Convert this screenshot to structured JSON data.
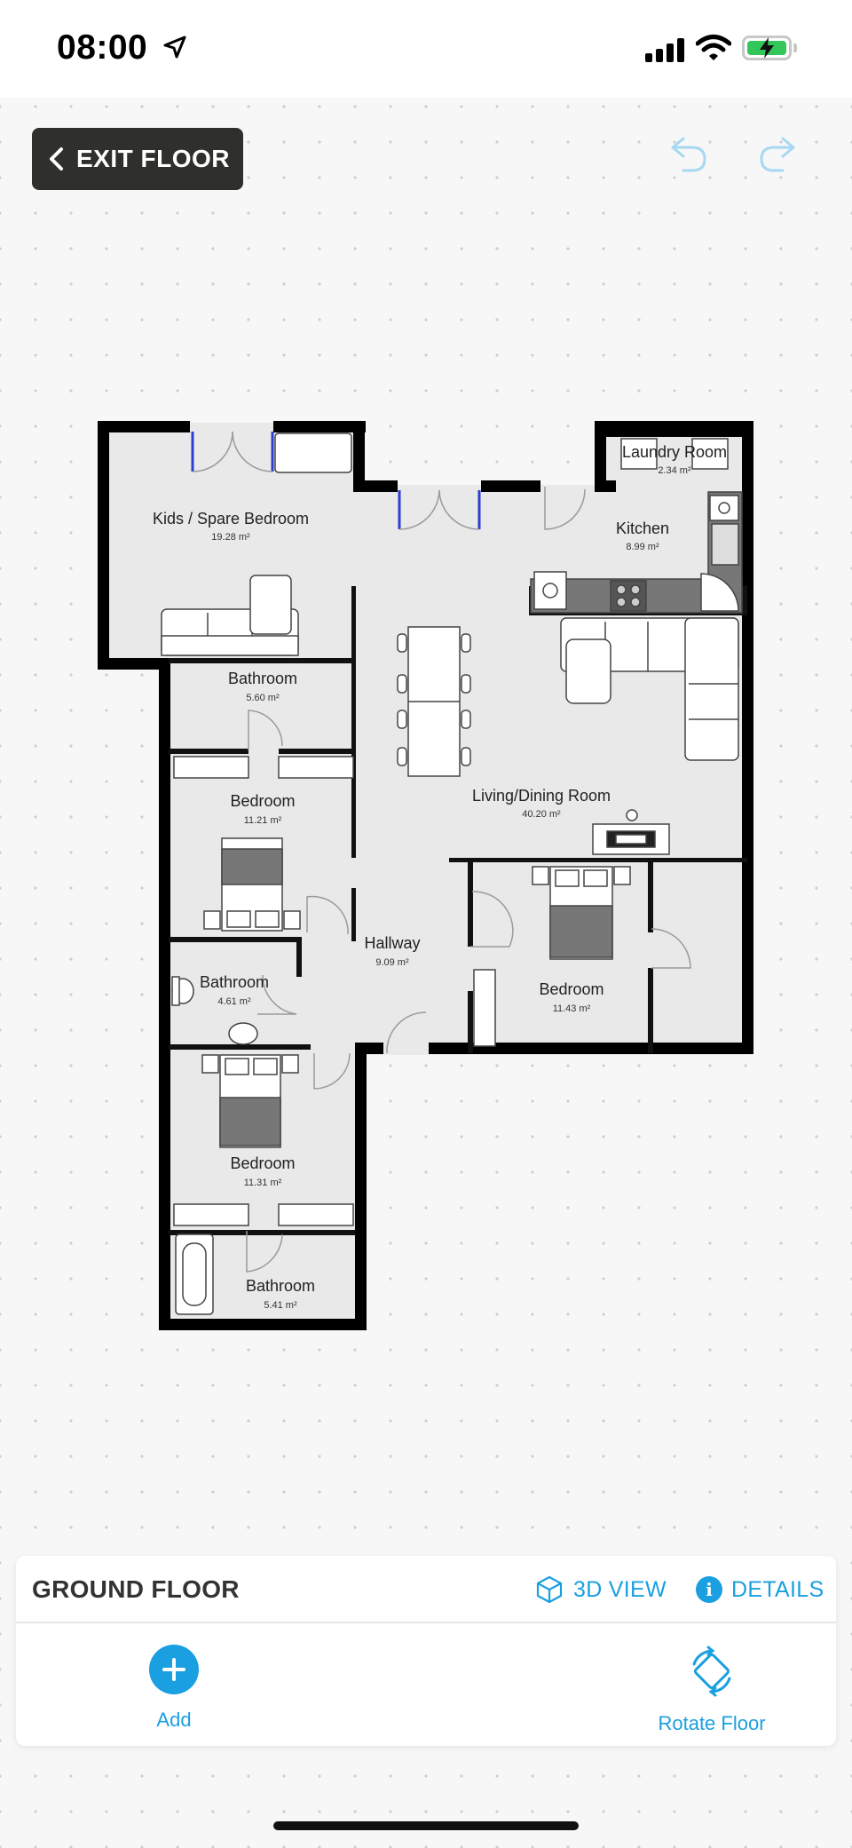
{
  "status_bar": {
    "time": "08:00",
    "location_icon": "location-arrow-icon",
    "signal_icon": "cellular-signal-icon",
    "wifi_icon": "wifi-icon",
    "battery_icon": "battery-charging-icon",
    "battery_color": "#33c759"
  },
  "toolbar": {
    "exit_label": "EXIT FLOOR",
    "undo_icon": "undo-icon",
    "redo_icon": "redo-icon"
  },
  "floor_plan": {
    "rooms": [
      {
        "name": "Kids / Spare Bedroom",
        "area": "19.28 m²"
      },
      {
        "name": "Laundry Room",
        "area": "2.34 m²"
      },
      {
        "name": "Kitchen",
        "area": "8.99 m²"
      },
      {
        "name": "Bathroom",
        "area": "5.60 m²"
      },
      {
        "name": "Bedroom",
        "area": "11.21 m²"
      },
      {
        "name": "Living/Dining Room",
        "area": "40.20 m²"
      },
      {
        "name": "Hallway",
        "area": "9.09 m²"
      },
      {
        "name": "Bathroom",
        "area": "4.61 m²"
      },
      {
        "name": "Bedroom",
        "area": "11.43 m²"
      },
      {
        "name": "Bedroom",
        "area": "11.31 m²"
      },
      {
        "name": "Bathroom",
        "area": "5.41 m²"
      }
    ]
  },
  "panel": {
    "floor_name": "GROUND FLOOR",
    "view_3d_label": "3D VIEW",
    "details_label": "DETAILS",
    "add_label": "Add",
    "rotate_label": "Rotate Floor",
    "accent_color": "#1a9fe0"
  }
}
